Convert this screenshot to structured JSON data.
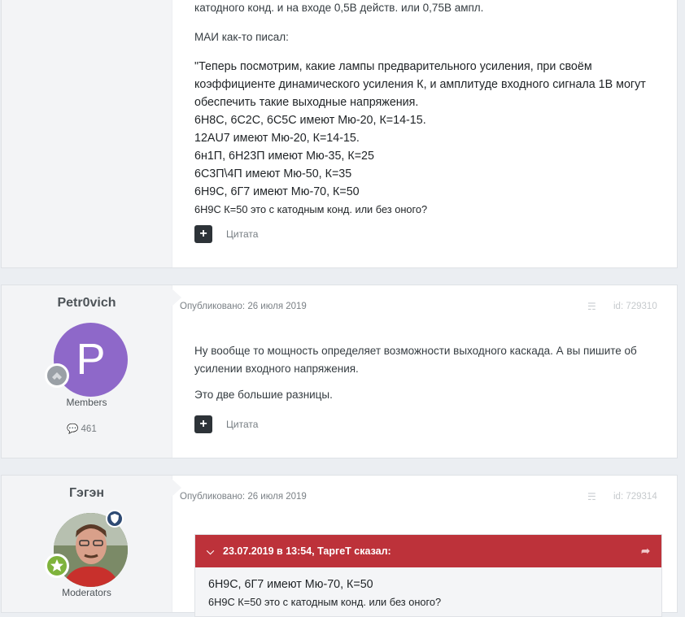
{
  "post1": {
    "top_line": "катодного конд. и на входе 0,5В действ. или 0,75В ампл.",
    "mai_line": "МАИ как-то писал:",
    "quote_lines": [
      "\"Теперь посмотрим, какие лампы предварительного усиления, при своём",
      "коэффициенте динамического усиления К, и амплитуде входного сигнала 1В могут",
      "обеспечить такие выходные напряжения.",
      "6Н8С, 6С2С, 6С5С имеют Мю-20, К=14-15.",
      "12AU7 имеют Мю-20, К=14-15.",
      "6н1П, 6Н23П имеют Мю-35, К=25",
      "6С3П\\4П имеют Мю-50, К=35",
      "6Н9С, 6Г7 имеют Мю-70, К=50"
    ],
    "last_line": "6Н9С  К=50 это с катодным конд. или без оного?",
    "plus_label": "+",
    "quote_label": "Цитата"
  },
  "post2": {
    "author": "Petr0vich",
    "avatar_letter": "P",
    "group": "Members",
    "post_count": "461",
    "posted": "Опубликовано: 26 июля 2019",
    "id": "id: 729310",
    "body_lines": [
      "Ну вообще то мощность определяет возможности выходного каскада. А вы пишите об",
      "усилении входного напряжения."
    ],
    "body_line2": "Это две большие разницы.",
    "plus_label": "+",
    "quote_label": "Цитата"
  },
  "post3": {
    "author": "Гэгэн",
    "group": "Moderators",
    "posted": "Опубликовано: 26 июля 2019",
    "id": "id: 729314",
    "quote_header": "23.07.2019 в 13:54, ТаргеТ сказал:",
    "quote_lines": [
      "6Н9С, 6Г7 имеют Мю-70, К=50",
      "6Н9С  К=50 это с катодным конд. или без оного?"
    ]
  },
  "colors": {
    "page_bg": "#ebeef2",
    "author_bg": "#f3f4f6",
    "quote_header": "#bd323a",
    "avatar_members": "#8e68c9"
  }
}
